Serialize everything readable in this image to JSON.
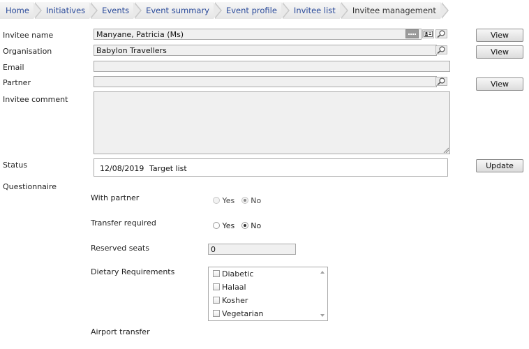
{
  "breadcrumb": [
    "Home",
    "Initiatives",
    "Events",
    "Event summary",
    "Event profile",
    "Invitee list",
    "Invitee management"
  ],
  "form": {
    "invitee_name_label": "Invitee name",
    "invitee_name_value": "Manyane, Patricia  (Ms)",
    "organisation_label": "Organisation",
    "organisation_value": "Babylon Travellers",
    "email_label": "Email",
    "email_value": "",
    "partner_label": "Partner",
    "partner_value": "",
    "comment_label": "Invitee comment",
    "comment_value": "",
    "status_label": "Status",
    "status_date": "12/08/2019",
    "status_value": "Target list",
    "questionnaire_label": "Questionnaire"
  },
  "buttons": {
    "view": "View",
    "update": "Update"
  },
  "questionnaire": {
    "with_partner_label": "With partner",
    "with_partner_selected": "No",
    "transfer_required_label": "Transfer required",
    "transfer_required_selected": "No",
    "yes": "Yes",
    "no": "No",
    "reserved_seats_label": "Reserved seats",
    "reserved_seats_value": "0",
    "dietary_label": "Dietary Requirements",
    "dietary_options": [
      "Diabetic",
      "Halaal",
      "Kosher",
      "Vegetarian"
    ],
    "airport_transfer_label": "Airport transfer"
  },
  "icons": {
    "more": "ellipsis-icon",
    "contact": "contact-card-icon",
    "search": "magnifier-icon"
  }
}
